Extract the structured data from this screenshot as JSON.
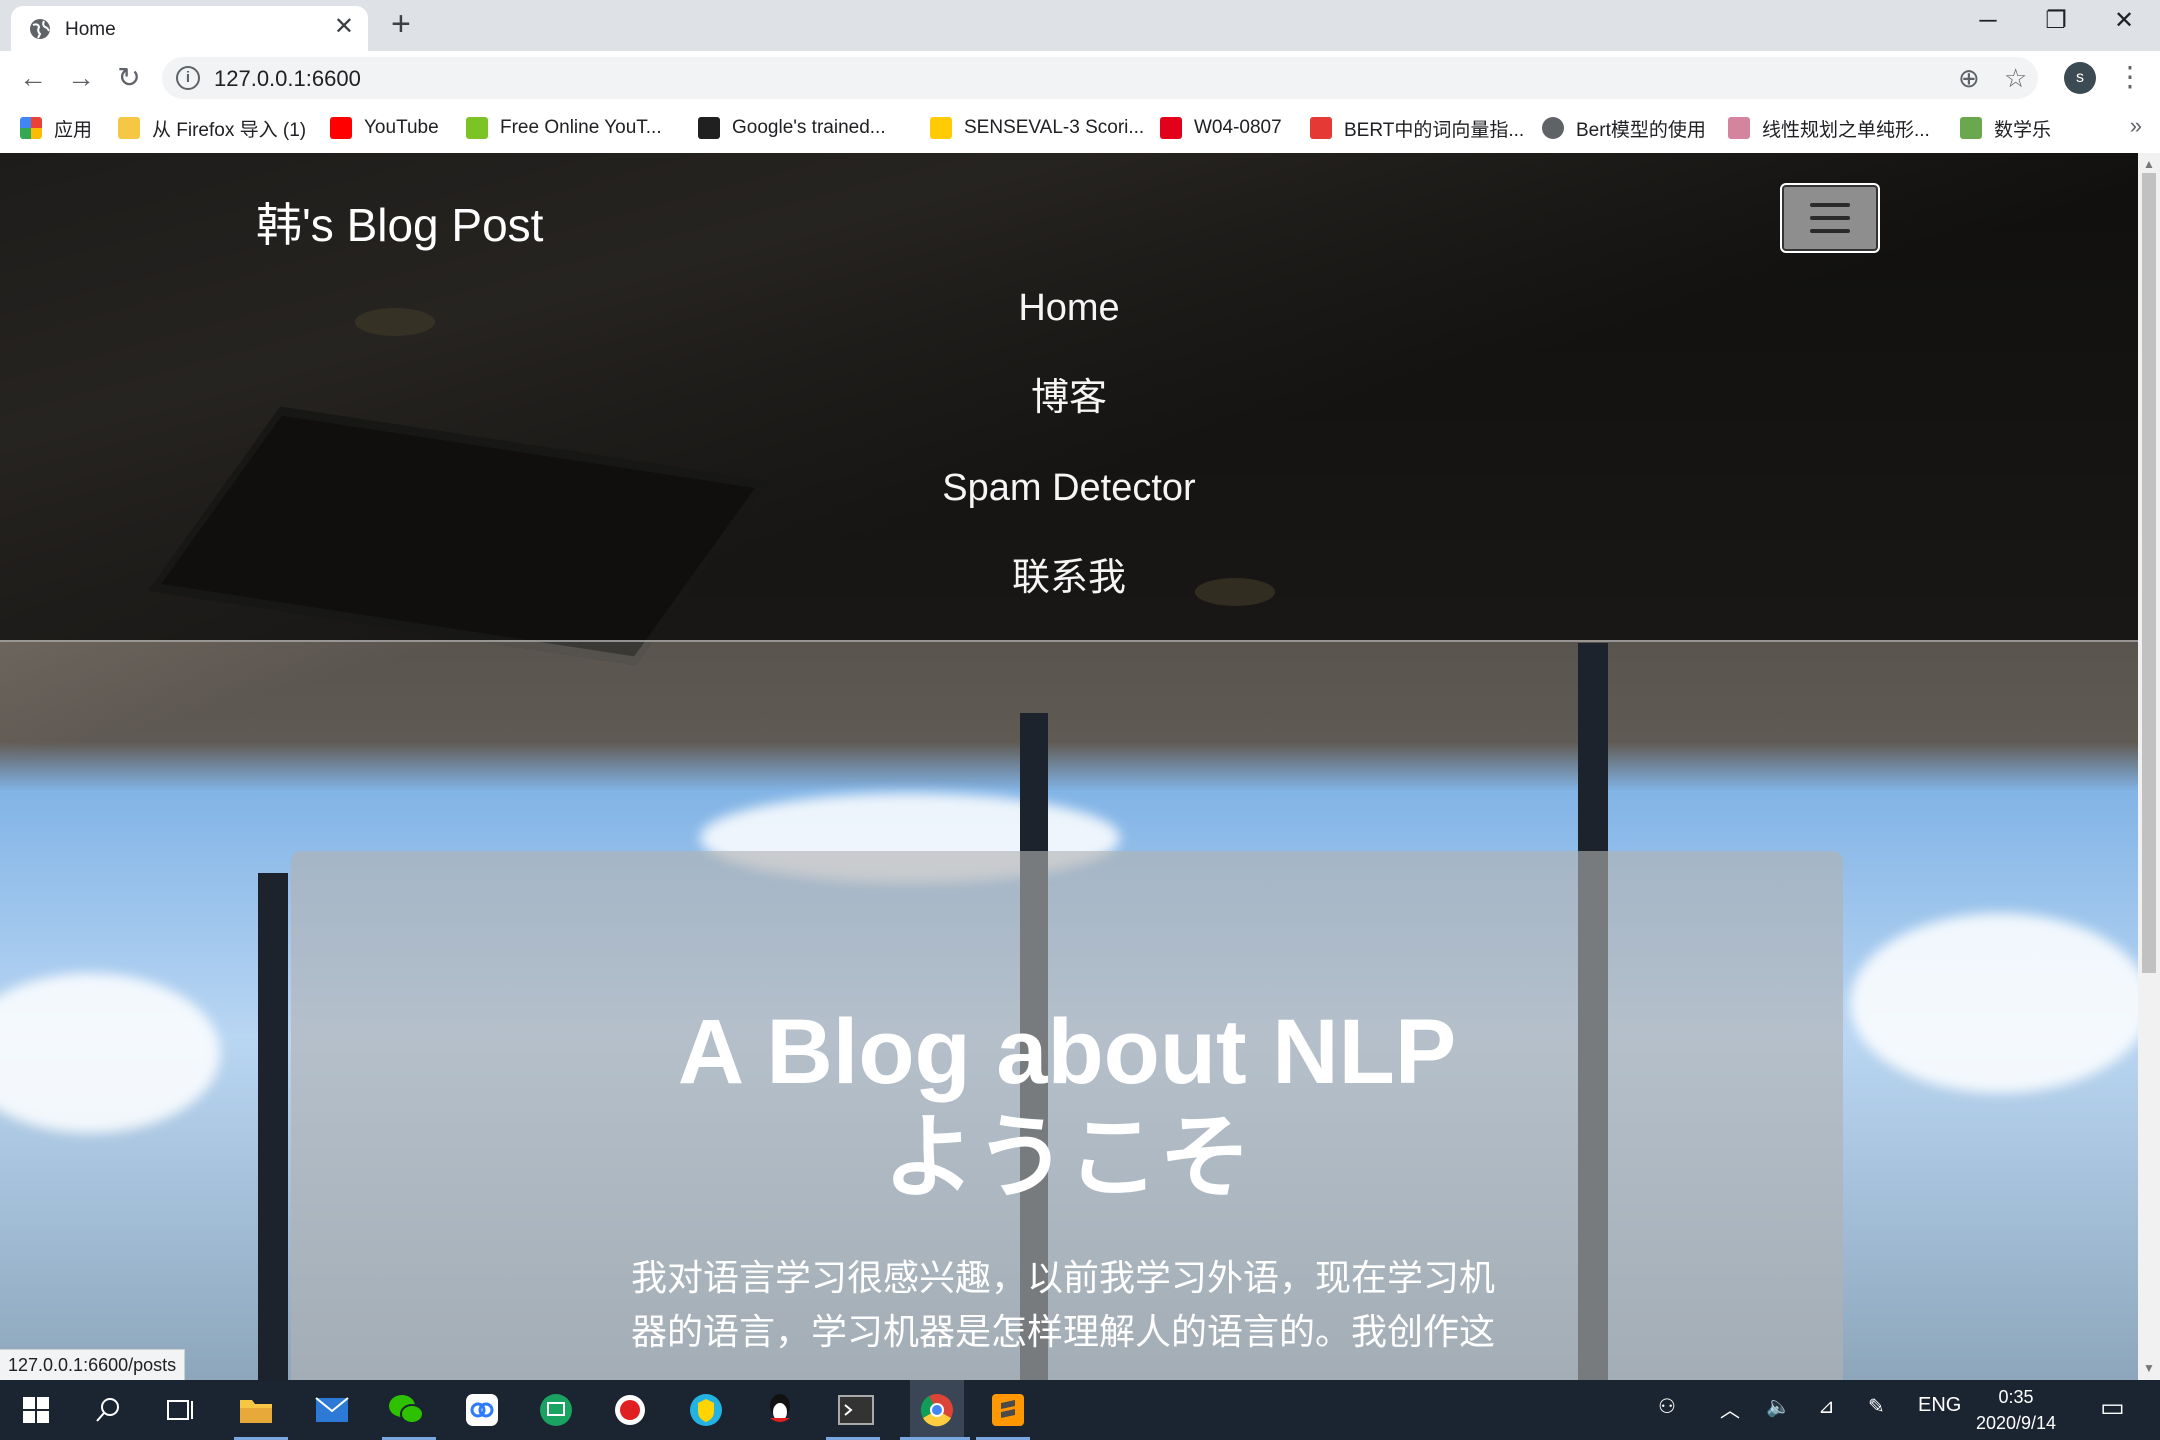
{
  "tab": {
    "title": "Home",
    "close": "✕",
    "new_tab": "+"
  },
  "window_controls": {
    "minimize": "─",
    "restore": "❐",
    "close": "✕"
  },
  "toolbar": {
    "back": "←",
    "forward": "→",
    "reload": "↻",
    "url": "127.0.0.1:6600",
    "info": "i",
    "zoom": "⊕",
    "star": "☆",
    "avatar": "s",
    "menu": "⋮"
  },
  "bookmarks": {
    "items": [
      {
        "label": "应用",
        "icon_color": "#ea4335"
      },
      {
        "label": "从 Firefox 导入 (1)",
        "icon_color": "#f6c744"
      },
      {
        "label": "YouTube",
        "icon_color": "#ff0000"
      },
      {
        "label": "Free Online YouT...",
        "icon_color": "#7cc425"
      },
      {
        "label": "Google's trained...",
        "icon_color": "#202020"
      },
      {
        "label": "SENSEVAL-3 Scori...",
        "icon_color": "#ffcb05"
      },
      {
        "label": "W04-0807",
        "icon_color": "#e2001a"
      },
      {
        "label": "BERT中的词向量指...",
        "icon_color": "#e53935"
      },
      {
        "label": "Bert模型的使用",
        "icon_color": "#5f6368"
      },
      {
        "label": "线性规划之单纯形...",
        "icon_color": "#d4849c"
      },
      {
        "label": "数学乐",
        "icon_color": "#6aa84f"
      }
    ],
    "more": "»"
  },
  "page": {
    "brand": "韩's Blog Post",
    "nav_links": [
      "Home",
      "博客",
      "Spam Detector",
      "联系我"
    ],
    "heading_line1": "A Blog about NLP",
    "heading_line2": "ようこそ",
    "intro_line1": "我对语言学习很感兴趣，以前我学习外语，现在学习机",
    "intro_line2": "器的语言，学习机器是怎样理解人的语言的。我创作这"
  },
  "status_bar": {
    "hover_url": "127.0.0.1:6600/posts"
  },
  "taskbar": {
    "lang": "ENG",
    "time": "0:35",
    "date": "2020/9/14"
  }
}
